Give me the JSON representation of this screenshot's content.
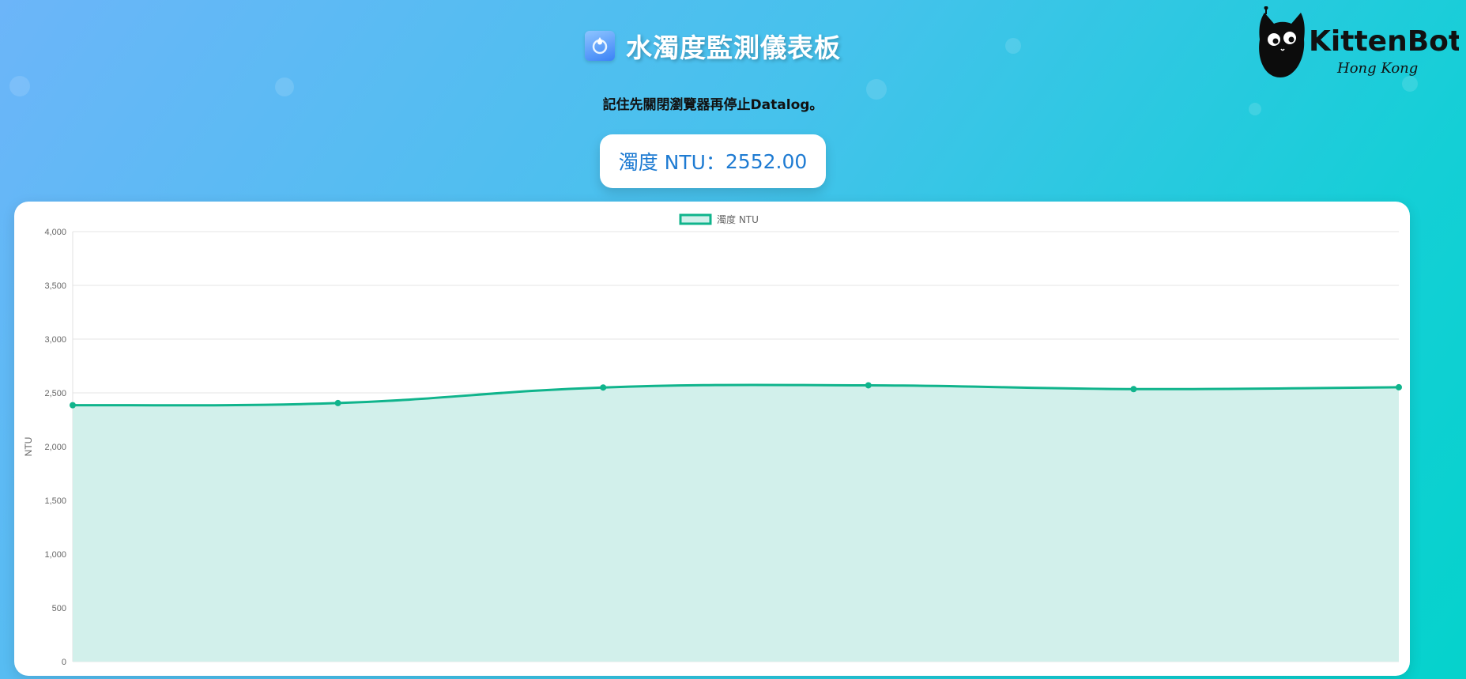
{
  "header": {
    "title": "水濁度監測儀表板",
    "title_icon": "water-sensor-icon",
    "notice": "記住先關閉瀏覽器再停止Datalog。"
  },
  "reading": {
    "label": "濁度 NTU：",
    "value": "2552.00"
  },
  "logo": {
    "brand": "KittenBot",
    "region": "Hong Kong"
  },
  "colors": {
    "accent_line": "#10b48c",
    "area_fill": "#d2f0eb",
    "reading_text": "#1e7bd2"
  },
  "chart_data": {
    "type": "area",
    "series": [
      {
        "name": "濁度 NTU",
        "values": [
          2385,
          2405,
          2550,
          2570,
          2535,
          2552
        ]
      }
    ],
    "x_labels": [],
    "ylabel": "NTU",
    "ylim": [
      0,
      4000
    ],
    "yticks": [
      0,
      500,
      1000,
      1500,
      2000,
      2500,
      3000,
      3500,
      4000
    ],
    "ytick_labels": [
      "0",
      "500",
      "1,000",
      "1,500",
      "2,000",
      "2,500",
      "3,000",
      "3,500",
      "4,000"
    ],
    "grid": true,
    "legend": "top-center",
    "smooth": true
  }
}
